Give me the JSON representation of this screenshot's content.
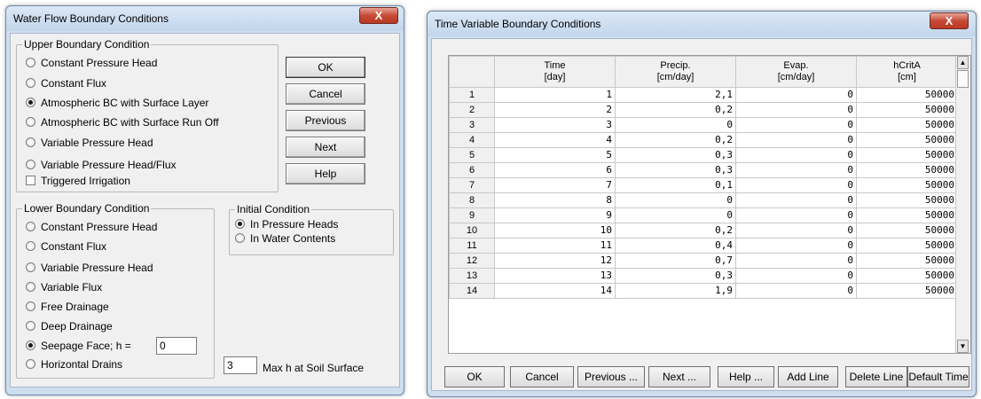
{
  "left_dialog": {
    "title": "Water Flow Boundary Conditions",
    "close_label": "X",
    "upper": {
      "legend": "Upper Boundary Condition",
      "options": [
        {
          "label": "Constant Pressure Head",
          "selected": false
        },
        {
          "label": "Constant Flux",
          "selected": false
        },
        {
          "label": "Atmospheric BC with Surface Layer",
          "selected": true
        },
        {
          "label": "Atmospheric BC with Surface Run Off",
          "selected": false
        },
        {
          "label": "Variable Pressure Head",
          "selected": false
        },
        {
          "label": "Variable Pressure Head/Flux",
          "selected": false
        }
      ],
      "triggered_irrigation": {
        "label": "Triggered Irrigation",
        "checked": false
      }
    },
    "buttons": {
      "ok": "OK",
      "cancel": "Cancel",
      "previous": "Previous",
      "next": "Next",
      "help": "Help"
    },
    "lower": {
      "legend": "Lower Boundary Condition",
      "options": [
        {
          "label": "Constant Pressure Head",
          "selected": false
        },
        {
          "label": "Constant Flux",
          "selected": false
        },
        {
          "label": "Variable Pressure Head",
          "selected": false
        },
        {
          "label": "Variable Flux",
          "selected": false
        },
        {
          "label": "Free Drainage",
          "selected": false
        },
        {
          "label": "Deep Drainage",
          "selected": false
        },
        {
          "label": "Seepage Face; h =",
          "selected": true
        },
        {
          "label": "Horizontal Drains",
          "selected": false
        }
      ],
      "seepage_value": "0"
    },
    "initial": {
      "legend": "Initial Condition",
      "options": [
        {
          "label": "In Pressure Heads",
          "selected": true
        },
        {
          "label": "In Water Contents",
          "selected": false
        }
      ]
    },
    "max_h": {
      "value": "3",
      "label": "Max h at Soil Surface"
    }
  },
  "right_dialog": {
    "title": "Time Variable Boundary Conditions",
    "close_label": "X",
    "columns": [
      {
        "name": "",
        "unit": ""
      },
      {
        "name": "Time",
        "unit": "[day]"
      },
      {
        "name": "Precip.",
        "unit": "[cm/day]"
      },
      {
        "name": "Evap.",
        "unit": "[cm/day]"
      },
      {
        "name": "hCritA",
        "unit": "[cm]"
      }
    ],
    "rows": [
      [
        "1",
        "1",
        "2,1",
        "0",
        "50000"
      ],
      [
        "2",
        "2",
        "0,2",
        "0",
        "50000"
      ],
      [
        "3",
        "3",
        "0",
        "0",
        "50000"
      ],
      [
        "4",
        "4",
        "0,2",
        "0",
        "50000"
      ],
      [
        "5",
        "5",
        "0,3",
        "0",
        "50000"
      ],
      [
        "6",
        "6",
        "0,3",
        "0",
        "50000"
      ],
      [
        "7",
        "7",
        "0,1",
        "0",
        "50000"
      ],
      [
        "8",
        "8",
        "0",
        "0",
        "50000"
      ],
      [
        "9",
        "9",
        "0",
        "0",
        "50000"
      ],
      [
        "10",
        "10",
        "0,2",
        "0",
        "50000"
      ],
      [
        "11",
        "11",
        "0,4",
        "0",
        "50000"
      ],
      [
        "12",
        "12",
        "0,7",
        "0",
        "50000"
      ],
      [
        "13",
        "13",
        "0,3",
        "0",
        "50000"
      ],
      [
        "14",
        "14",
        "1,9",
        "0",
        "50000"
      ]
    ],
    "buttons": {
      "ok": "OK",
      "cancel": "Cancel",
      "previous": "Previous ...",
      "next": "Next ...",
      "help": "Help ...",
      "add_line": "Add Line",
      "delete_line": "Delete Line",
      "default_time": "Default Time"
    }
  }
}
